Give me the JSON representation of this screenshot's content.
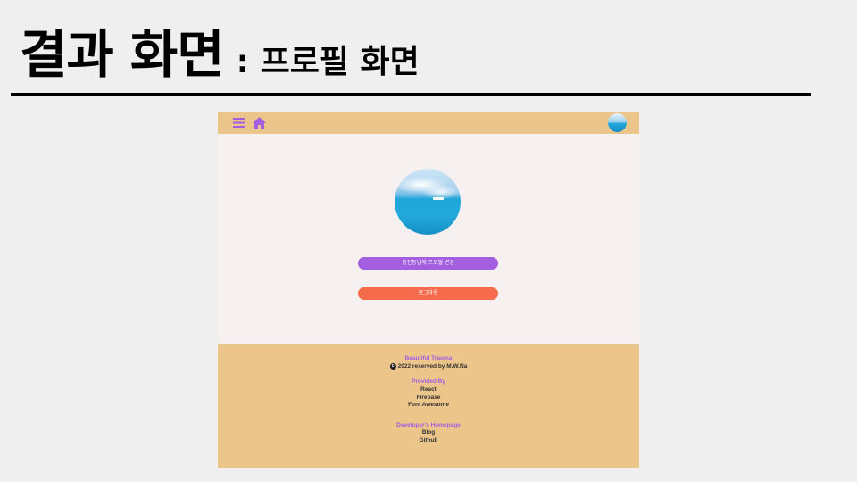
{
  "slide": {
    "title_main": "결과 화면",
    "title_sub": ": 프로필 화면"
  },
  "app": {
    "navbar": {
      "menu_icon": "bars-icon",
      "home_icon": "home-icon",
      "accent_color": "#a45ee0",
      "background_color": "#ecc58a"
    },
    "profile": {
      "edit_button_label": "홍진동님에 프로필 변경",
      "logout_button_label": "로그아웃",
      "edit_button_color": "#a45ee0",
      "logout_button_color": "#f76b4d"
    },
    "footer": {
      "brand_title": "Beautiful Trauma",
      "copyright": "2022 reserved by M.W.Na",
      "copyright_icon": "copyright-icon",
      "provided_title": "Provided By",
      "provided_items": [
        "React",
        "Firebase",
        "Font Awesome"
      ],
      "dev_title": "Developer's Homepage",
      "dev_links": [
        "Blog",
        "Github"
      ]
    }
  }
}
